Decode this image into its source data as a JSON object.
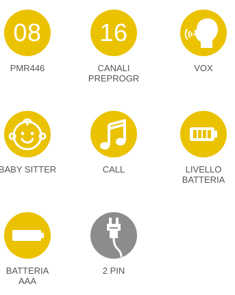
{
  "colors": {
    "yellow": "#EAC200",
    "gray": "#8C8C8C",
    "white": "#FFFFFF",
    "label": "#555555"
  },
  "features": [
    {
      "id": "pmr446",
      "icon_text": "08",
      "label_lines": [
        "PMR446"
      ]
    },
    {
      "id": "canali",
      "icon_text": "16",
      "label_lines": [
        "CANALI",
        "PREPROGR"
      ]
    },
    {
      "id": "vox",
      "icon": "voice-head-icon",
      "label_lines": [
        "VOX"
      ]
    },
    {
      "id": "baby-sitter",
      "icon": "baby-face-icon",
      "label_lines": [
        "BABY SITTER"
      ]
    },
    {
      "id": "call",
      "icon": "music-note-icon",
      "label_lines": [
        "CALL"
      ]
    },
    {
      "id": "livello-batteria",
      "icon": "battery-level-icon",
      "label_lines": [
        "LIVELLO",
        "BATTERIA"
      ]
    },
    {
      "id": "batteria-aaa",
      "icon": "battery-aaa-icon",
      "label_lines": [
        "BATTERIA",
        "AAA"
      ]
    },
    {
      "id": "2-pin",
      "icon": "two-pin-plug-icon",
      "label_lines": [
        "2 PIN"
      ]
    }
  ]
}
